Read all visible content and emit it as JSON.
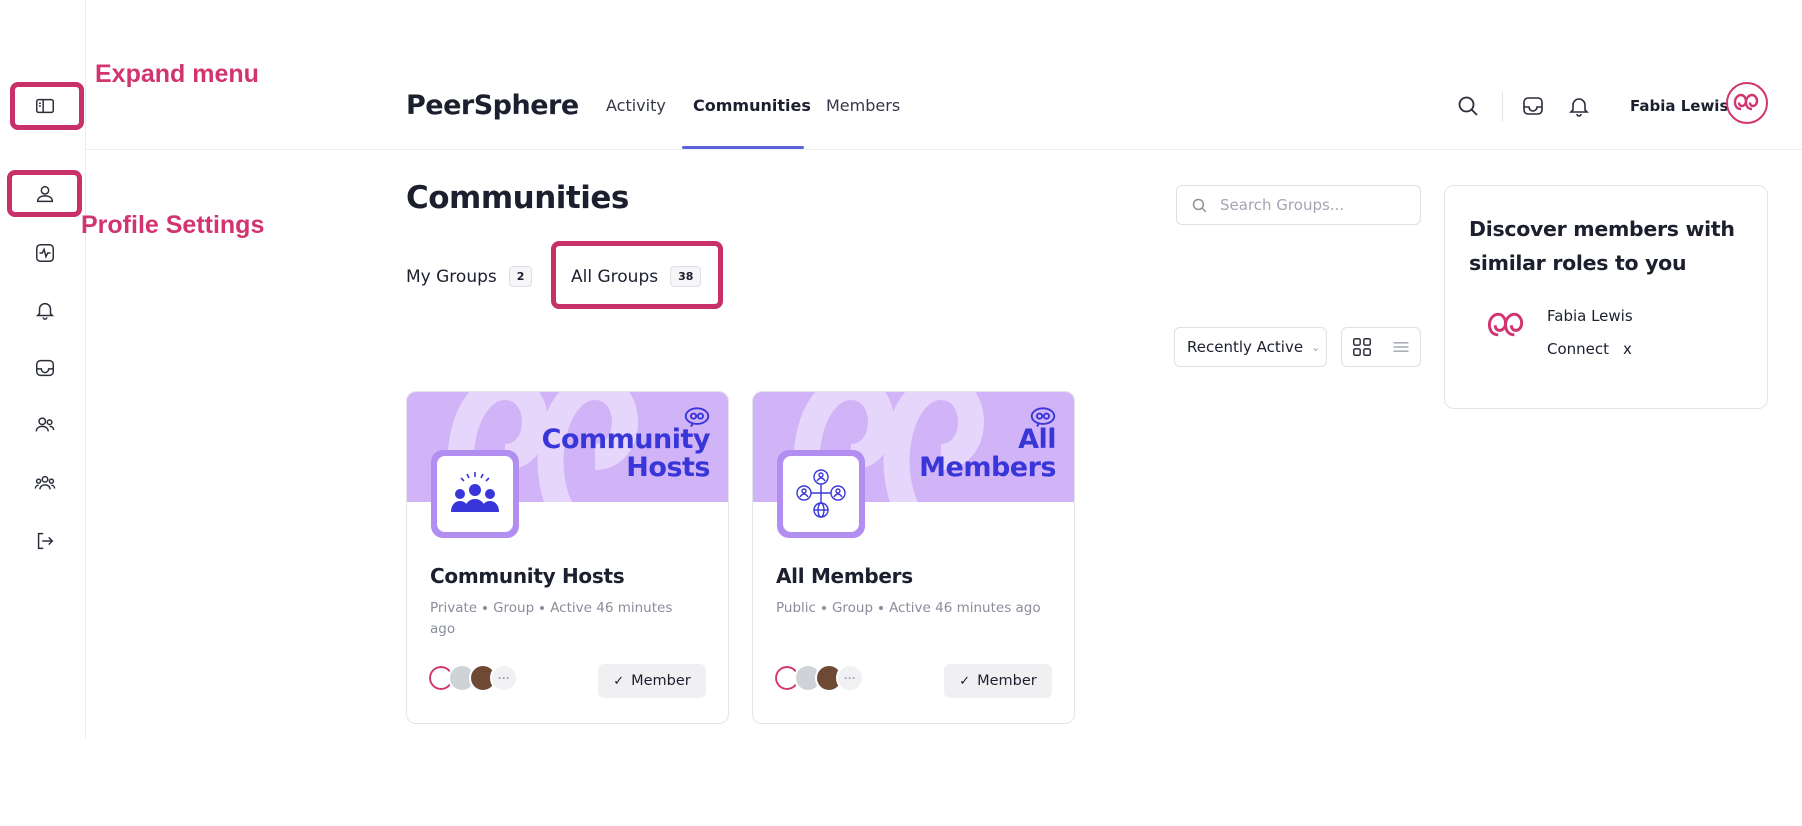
{
  "annotations": {
    "expand_menu": "Expand menu",
    "profile_settings": "Profile Settings"
  },
  "sidebar": {
    "items": [
      {
        "name": "expand-menu",
        "icon": "sidebar-toggle-icon"
      },
      {
        "name": "profile",
        "icon": "user-icon"
      },
      {
        "name": "activity",
        "icon": "activity-icon"
      },
      {
        "name": "notifications",
        "icon": "bell-icon"
      },
      {
        "name": "inbox",
        "icon": "inbox-icon"
      },
      {
        "name": "members",
        "icon": "users-icon"
      },
      {
        "name": "groups",
        "icon": "group-icon"
      },
      {
        "name": "logout",
        "icon": "logout-icon"
      }
    ]
  },
  "header": {
    "brand": "PeerSphere",
    "nav": [
      {
        "label": "Activity",
        "active": false
      },
      {
        "label": "Communities",
        "active": true
      },
      {
        "label": "Members",
        "active": false
      }
    ],
    "user_name": "Fabia Lewis"
  },
  "main": {
    "title": "Communities",
    "tabs": [
      {
        "label": "My Groups",
        "count": "2"
      },
      {
        "label": "All Groups",
        "count": "38"
      }
    ],
    "search_placeholder": "Search Groups...",
    "sort_label": "Recently Active"
  },
  "cards": [
    {
      "banner_line1": "Community",
      "banner_line2": "Hosts",
      "name": "Community Hosts",
      "privacy": "Private",
      "type": "Group",
      "activity": "Active 46 minutes ago",
      "button": "Member"
    },
    {
      "banner_line1": "All",
      "banner_line2": "Members",
      "name": "All Members",
      "privacy": "Public",
      "type": "Group",
      "activity": "Active 46 minutes ago",
      "button": "Member"
    }
  ],
  "discover": {
    "title": "Discover members with similar roles to you",
    "member_name": "Fabia Lewis",
    "connect_label": "Connect",
    "dismiss_label": "x"
  },
  "colors": {
    "accent": "#5a63d8",
    "annotation": "#d2346f",
    "banner": "#d1b3f7",
    "banner_text": "#3836d8"
  }
}
